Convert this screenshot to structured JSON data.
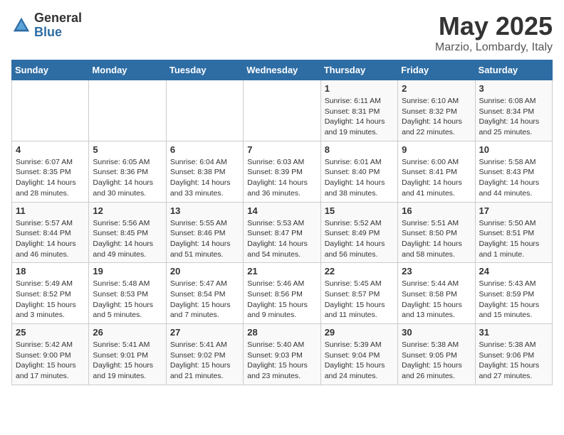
{
  "logo": {
    "general": "General",
    "blue": "Blue"
  },
  "calendar": {
    "title": "May 2025",
    "subtitle": "Marzio, Lombardy, Italy",
    "days_header": [
      "Sunday",
      "Monday",
      "Tuesday",
      "Wednesday",
      "Thursday",
      "Friday",
      "Saturday"
    ],
    "weeks": [
      [
        {
          "day": "",
          "info": ""
        },
        {
          "day": "",
          "info": ""
        },
        {
          "day": "",
          "info": ""
        },
        {
          "day": "",
          "info": ""
        },
        {
          "day": "1",
          "info": "Sunrise: 6:11 AM\nSunset: 8:31 PM\nDaylight: 14 hours\nand 19 minutes."
        },
        {
          "day": "2",
          "info": "Sunrise: 6:10 AM\nSunset: 8:32 PM\nDaylight: 14 hours\nand 22 minutes."
        },
        {
          "day": "3",
          "info": "Sunrise: 6:08 AM\nSunset: 8:34 PM\nDaylight: 14 hours\nand 25 minutes."
        }
      ],
      [
        {
          "day": "4",
          "info": "Sunrise: 6:07 AM\nSunset: 8:35 PM\nDaylight: 14 hours\nand 28 minutes."
        },
        {
          "day": "5",
          "info": "Sunrise: 6:05 AM\nSunset: 8:36 PM\nDaylight: 14 hours\nand 30 minutes."
        },
        {
          "day": "6",
          "info": "Sunrise: 6:04 AM\nSunset: 8:38 PM\nDaylight: 14 hours\nand 33 minutes."
        },
        {
          "day": "7",
          "info": "Sunrise: 6:03 AM\nSunset: 8:39 PM\nDaylight: 14 hours\nand 36 minutes."
        },
        {
          "day": "8",
          "info": "Sunrise: 6:01 AM\nSunset: 8:40 PM\nDaylight: 14 hours\nand 38 minutes."
        },
        {
          "day": "9",
          "info": "Sunrise: 6:00 AM\nSunset: 8:41 PM\nDaylight: 14 hours\nand 41 minutes."
        },
        {
          "day": "10",
          "info": "Sunrise: 5:58 AM\nSunset: 8:43 PM\nDaylight: 14 hours\nand 44 minutes."
        }
      ],
      [
        {
          "day": "11",
          "info": "Sunrise: 5:57 AM\nSunset: 8:44 PM\nDaylight: 14 hours\nand 46 minutes."
        },
        {
          "day": "12",
          "info": "Sunrise: 5:56 AM\nSunset: 8:45 PM\nDaylight: 14 hours\nand 49 minutes."
        },
        {
          "day": "13",
          "info": "Sunrise: 5:55 AM\nSunset: 8:46 PM\nDaylight: 14 hours\nand 51 minutes."
        },
        {
          "day": "14",
          "info": "Sunrise: 5:53 AM\nSunset: 8:47 PM\nDaylight: 14 hours\nand 54 minutes."
        },
        {
          "day": "15",
          "info": "Sunrise: 5:52 AM\nSunset: 8:49 PM\nDaylight: 14 hours\nand 56 minutes."
        },
        {
          "day": "16",
          "info": "Sunrise: 5:51 AM\nSunset: 8:50 PM\nDaylight: 14 hours\nand 58 minutes."
        },
        {
          "day": "17",
          "info": "Sunrise: 5:50 AM\nSunset: 8:51 PM\nDaylight: 15 hours\nand 1 minute."
        }
      ],
      [
        {
          "day": "18",
          "info": "Sunrise: 5:49 AM\nSunset: 8:52 PM\nDaylight: 15 hours\nand 3 minutes."
        },
        {
          "day": "19",
          "info": "Sunrise: 5:48 AM\nSunset: 8:53 PM\nDaylight: 15 hours\nand 5 minutes."
        },
        {
          "day": "20",
          "info": "Sunrise: 5:47 AM\nSunset: 8:54 PM\nDaylight: 15 hours\nand 7 minutes."
        },
        {
          "day": "21",
          "info": "Sunrise: 5:46 AM\nSunset: 8:56 PM\nDaylight: 15 hours\nand 9 minutes."
        },
        {
          "day": "22",
          "info": "Sunrise: 5:45 AM\nSunset: 8:57 PM\nDaylight: 15 hours\nand 11 minutes."
        },
        {
          "day": "23",
          "info": "Sunrise: 5:44 AM\nSunset: 8:58 PM\nDaylight: 15 hours\nand 13 minutes."
        },
        {
          "day": "24",
          "info": "Sunrise: 5:43 AM\nSunset: 8:59 PM\nDaylight: 15 hours\nand 15 minutes."
        }
      ],
      [
        {
          "day": "25",
          "info": "Sunrise: 5:42 AM\nSunset: 9:00 PM\nDaylight: 15 hours\nand 17 minutes."
        },
        {
          "day": "26",
          "info": "Sunrise: 5:41 AM\nSunset: 9:01 PM\nDaylight: 15 hours\nand 19 minutes."
        },
        {
          "day": "27",
          "info": "Sunrise: 5:41 AM\nSunset: 9:02 PM\nDaylight: 15 hours\nand 21 minutes."
        },
        {
          "day": "28",
          "info": "Sunrise: 5:40 AM\nSunset: 9:03 PM\nDaylight: 15 hours\nand 23 minutes."
        },
        {
          "day": "29",
          "info": "Sunrise: 5:39 AM\nSunset: 9:04 PM\nDaylight: 15 hours\nand 24 minutes."
        },
        {
          "day": "30",
          "info": "Sunrise: 5:38 AM\nSunset: 9:05 PM\nDaylight: 15 hours\nand 26 minutes."
        },
        {
          "day": "31",
          "info": "Sunrise: 5:38 AM\nSunset: 9:06 PM\nDaylight: 15 hours\nand 27 minutes."
        }
      ]
    ]
  }
}
